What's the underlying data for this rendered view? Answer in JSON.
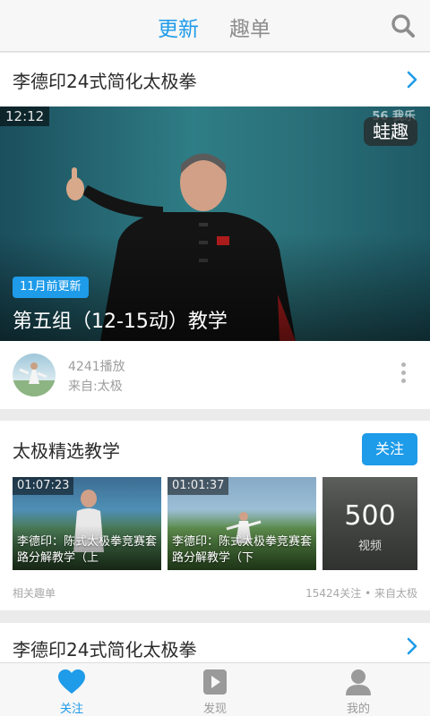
{
  "header": {
    "tabs": [
      {
        "label": "更新",
        "active": true
      },
      {
        "label": "趣单",
        "active": false
      }
    ],
    "search_icon": "search-icon"
  },
  "card1": {
    "title": "李德印24式简化太极拳",
    "video": {
      "duration": "12:12",
      "watermark": "蛙趣",
      "watermark_top": "56 我乐",
      "update_badge": "11月前更新",
      "caption": "第五组（12-15动）教学"
    },
    "plays": "4241播放",
    "source": "来自:太极"
  },
  "card2": {
    "title": "太极精选教学",
    "follow_label": "关注",
    "thumbs": [
      {
        "duration": "01:07:23",
        "title": "李德印：陈式太极拳竞赛套路分解教学（上"
      },
      {
        "duration": "01:01:37",
        "title": "李德印：陈式太极拳竞赛套路分解教学（下"
      }
    ],
    "video_count": "500",
    "video_count_label": "视频",
    "footer_left": "相关趣单",
    "footer_right": "15424关注 • 来自太极"
  },
  "card3": {
    "title": "李德印24式简化太极拳"
  },
  "bottom_nav": [
    {
      "label": "关注",
      "icon": "heart-icon",
      "active": true
    },
    {
      "label": "发现",
      "icon": "play-icon",
      "active": false
    },
    {
      "label": "我的",
      "icon": "user-icon",
      "active": false
    }
  ],
  "colors": {
    "accent": "#1e9be9",
    "text": "#2b2b2b",
    "muted": "#9e9e9e"
  }
}
